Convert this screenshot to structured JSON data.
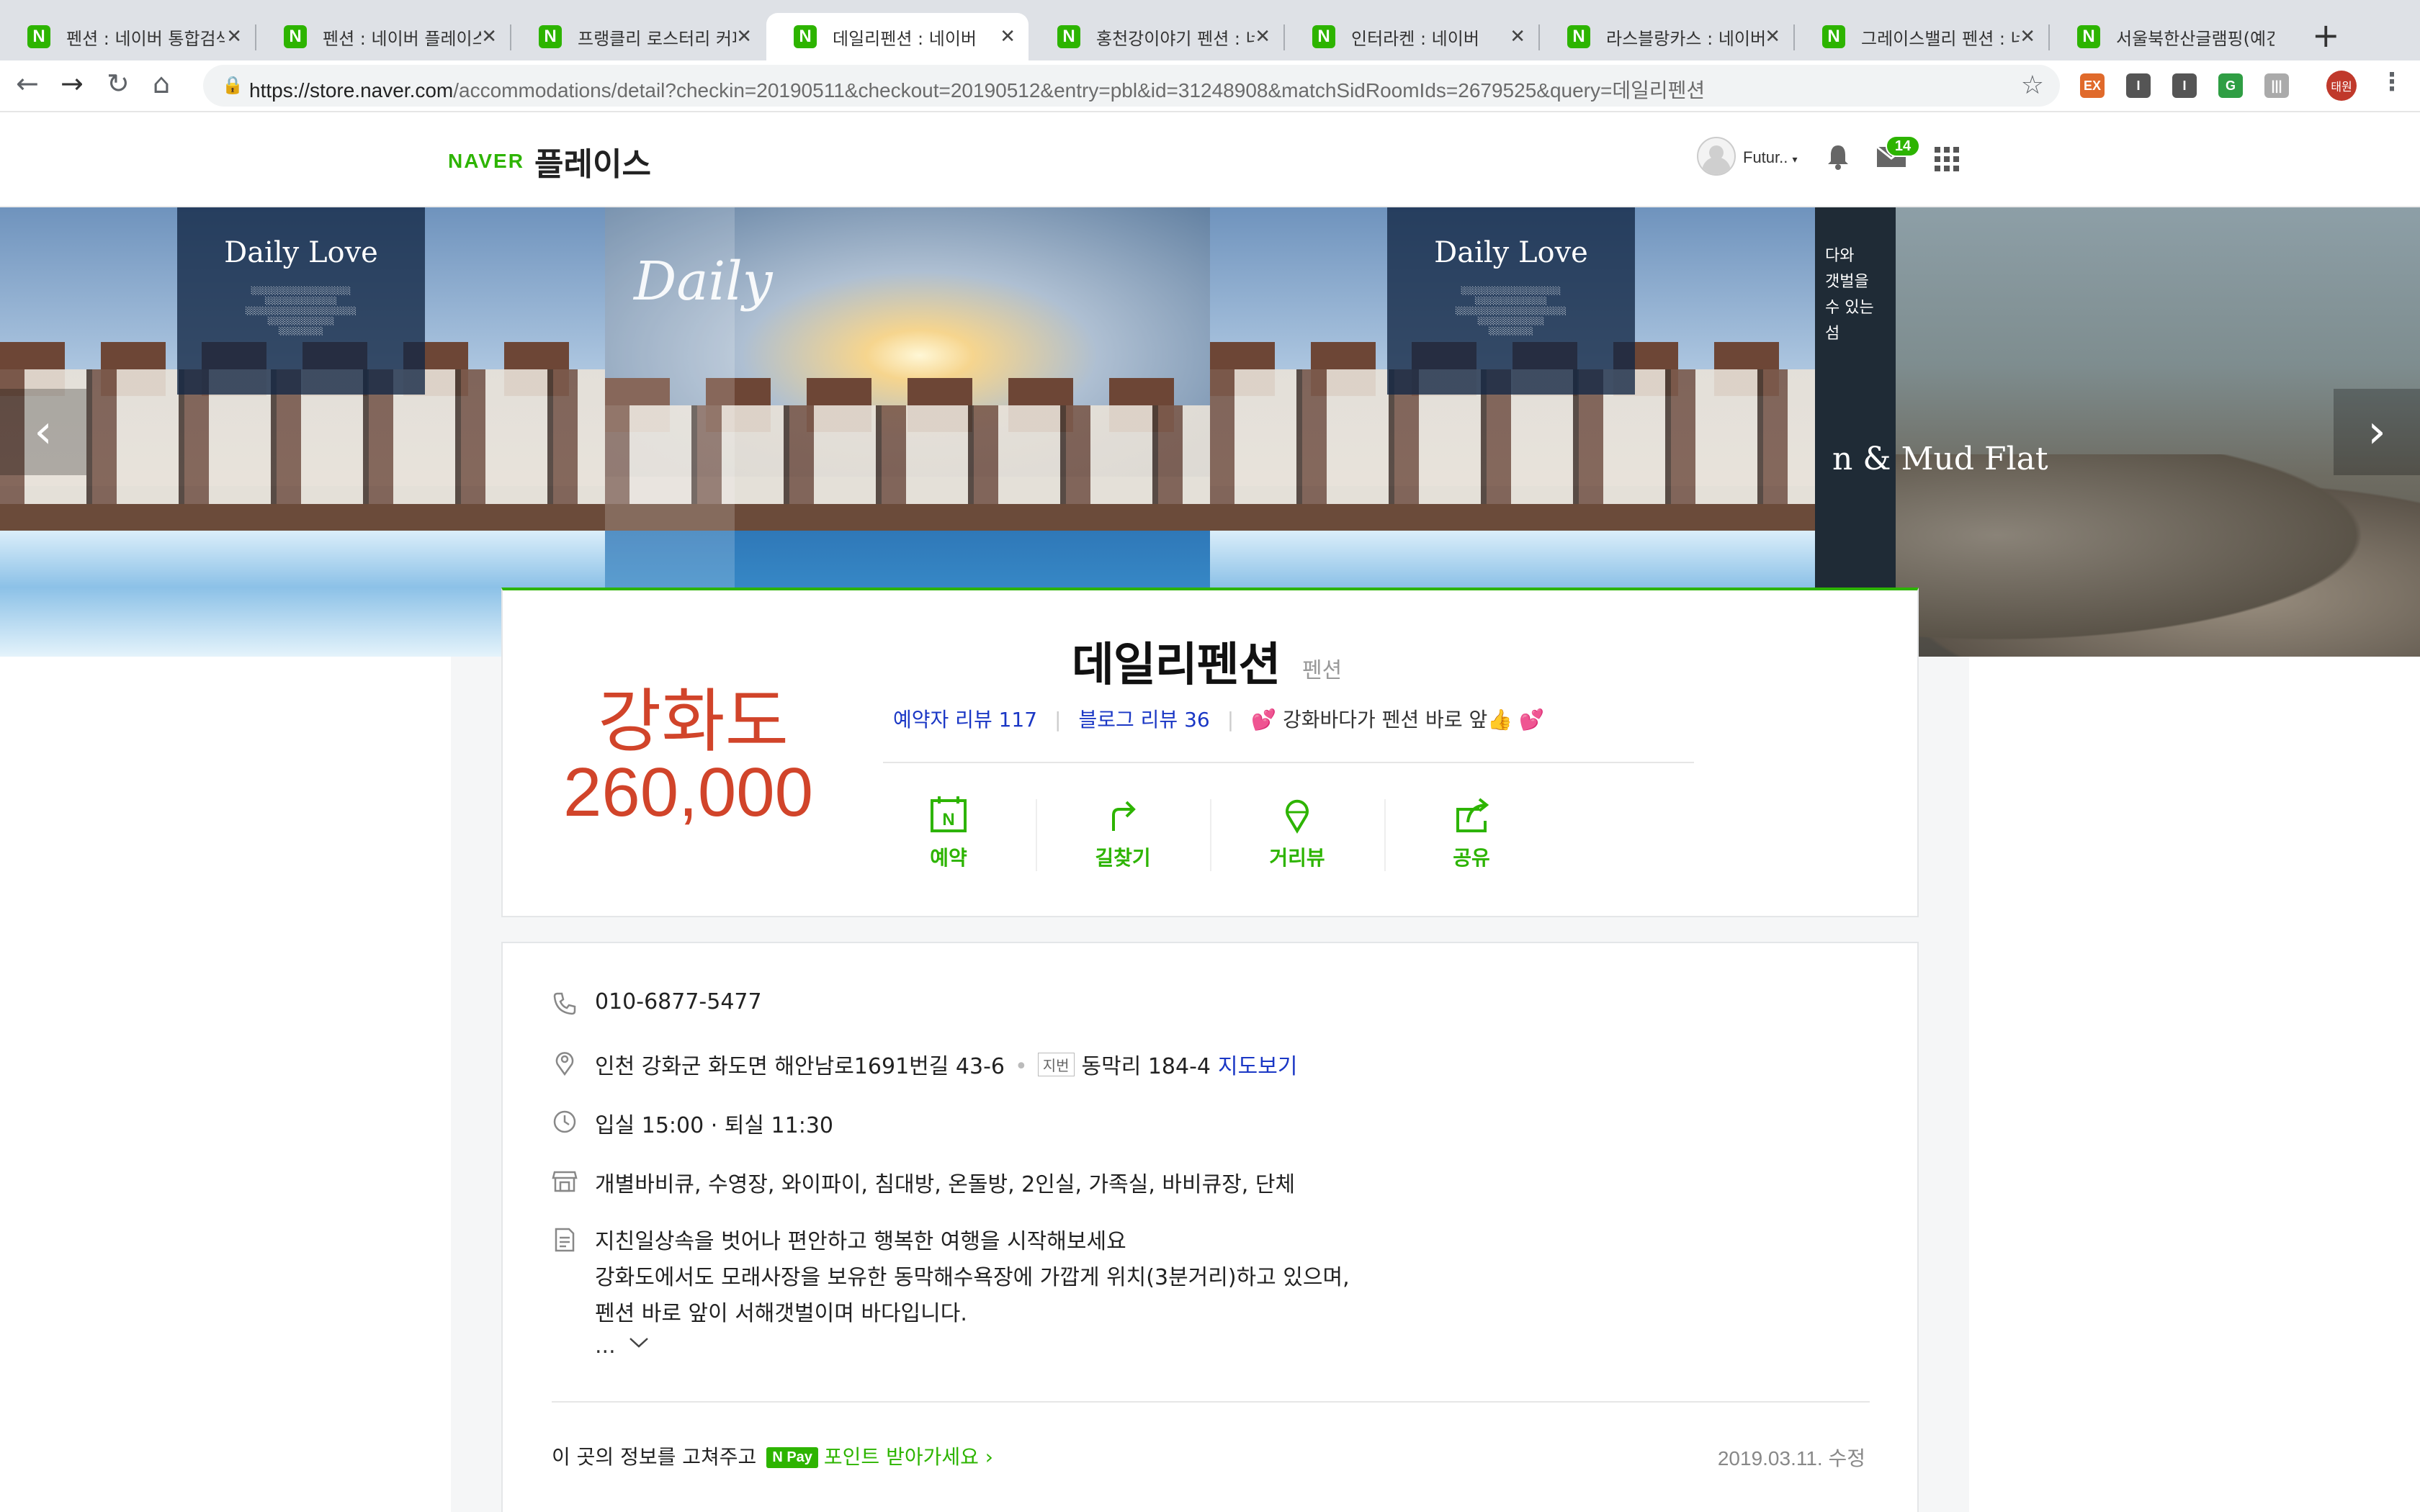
{
  "browser": {
    "tabs": [
      {
        "title": "펜션 : 네이버 통합검색",
        "active": false
      },
      {
        "title": "펜션 : 네이버 플레이스",
        "active": false
      },
      {
        "title": "프랭클리 로스터리 커피",
        "active": false
      },
      {
        "title": "데일리펜션 : 네이버",
        "active": true
      },
      {
        "title": "홍천강이야기 펜션 : 네이",
        "active": false
      },
      {
        "title": "인터라켄 : 네이버",
        "active": false
      },
      {
        "title": "라스블랑카스 : 네이버",
        "active": false
      },
      {
        "title": "그레이스밸리 펜션 : 네이",
        "active": false
      },
      {
        "title": "서울북한산글램핑(예건",
        "active": false
      }
    ],
    "tab_favicon_letter": "N",
    "new_tab": "+",
    "url_host": "https://store.naver.com",
    "url_path": "/accommodations/detail?checkin=20190511&checkout=20190512&entry=pbl&id=31248908&matchSidRoomIds=2679525&query=데일리펜션",
    "extensions": [
      "EX",
      "I",
      "I",
      "G",
      "|||"
    ],
    "profile_label": "태원"
  },
  "header": {
    "naver_logo": "NAVER",
    "service_name": "플레이스",
    "user_name": "Futur..",
    "mail_count": "14"
  },
  "hero": {
    "slide_titles": [
      "Daily Love",
      "Daily",
      "Daily Love"
    ],
    "slide_korean": "다와\n갯벌을\n수 있는\n섬",
    "slide_caption": "n & Mud Flat",
    "prev": "‹",
    "next": "›"
  },
  "place": {
    "name": "데일리펜션",
    "category": "펜션",
    "region": "강화도",
    "price": "260,000",
    "booker_review": "예약자 리뷰 117",
    "blog_review": "블로그 리뷰 36",
    "promo": "강화바다가 펜션 바로 앞",
    "actions": [
      "예약",
      "길찾기",
      "거리뷰",
      "공유"
    ]
  },
  "info": {
    "phone": "010-6877-5477",
    "address": "인천 강화군 화도면 해안남로1691번길 43-6",
    "jibun_label": "지번",
    "jibun": "동막리 184-4",
    "map_link": "지도보기",
    "checkin": "입실 15:00",
    "checkout": "퇴실 11:30",
    "facilities": "개별바비큐, 수영장, 와이파이, 침대방, 온돌방, 2인실, 가족실, 바비큐장, 단체",
    "desc_lines": [
      "지친일상속을 벗어나 편안하고 행복한 여행을 시작해보세요",
      "강화도에서도 모래사장을 보유한 동막해수욕장에 가깝게 위치(3분거리)하고 있으며,",
      "펜션 바로 앞이 서해갯벌이며 바다입니다."
    ],
    "more": "...",
    "fix_prefix": "이 곳의 정보를 고쳐주고",
    "npay": "N Pay",
    "fix_link": "포인트 받아가세요 ›",
    "modified": "2019.03.11. 수정"
  }
}
